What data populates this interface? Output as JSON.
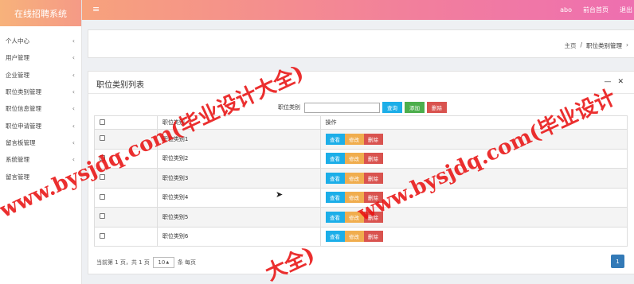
{
  "app": {
    "title": "在线招聘系统"
  },
  "sidebar": {
    "items": [
      {
        "label": "个人中心",
        "chevron": "‹"
      },
      {
        "label": "用户管理",
        "chevron": "‹"
      },
      {
        "label": "企业管理",
        "chevron": "‹"
      },
      {
        "label": "职位类别管理",
        "chevron": "‹"
      },
      {
        "label": "职位信息管理",
        "chevron": "‹"
      },
      {
        "label": "职位申请管理",
        "chevron": "‹"
      },
      {
        "label": "留言板管理",
        "chevron": "‹"
      },
      {
        "label": "系统管理",
        "chevron": "‹"
      },
      {
        "label": "留言管理",
        "chevron": ""
      }
    ]
  },
  "topbar": {
    "menu_icon": "≡",
    "user": "abo",
    "home_link": "前台首页",
    "logout_link": "退出"
  },
  "breadcrumb": {
    "home": "主页",
    "separator": "/",
    "current": "职位类别管理",
    "trailing": "›"
  },
  "panel": {
    "title": "职位类别列表",
    "minimize": "—",
    "close": "✕"
  },
  "search": {
    "label": "职位类别",
    "value": "",
    "query_btn": "查询",
    "add_btn": "添加",
    "delete_btn": "删除"
  },
  "table": {
    "headers": [
      "",
      "职位类别",
      "操作"
    ],
    "rows": [
      {
        "name": "职位类别1"
      },
      {
        "name": "职位类别2"
      },
      {
        "name": "职位类别3"
      },
      {
        "name": "职位类别4"
      },
      {
        "name": "职位类别5"
      },
      {
        "name": "职位类别6"
      }
    ],
    "actions": {
      "view": "查看",
      "edit": "修改",
      "delete": "删除"
    }
  },
  "pagination": {
    "info": "当前第 1 页，共 1 页",
    "page_size": "10",
    "page_size_suffix": "条 每页",
    "current_page": "1"
  },
  "watermarks": {
    "text": "www.bysjdq.com(毕业设计大全)",
    "partial": "www.bysjdq.com(毕业设计",
    "fragment": "大全)"
  },
  "colors": {
    "primary_blue": "#1caee8",
    "success_green": "#4cae4c",
    "danger_red": "#d9534f",
    "warning_orange": "#f0ad4e",
    "page_blue": "#337ab7",
    "topbar_start": "#f7a27c",
    "topbar_end": "#ee6fb0",
    "watermark_red": "#e81212"
  }
}
